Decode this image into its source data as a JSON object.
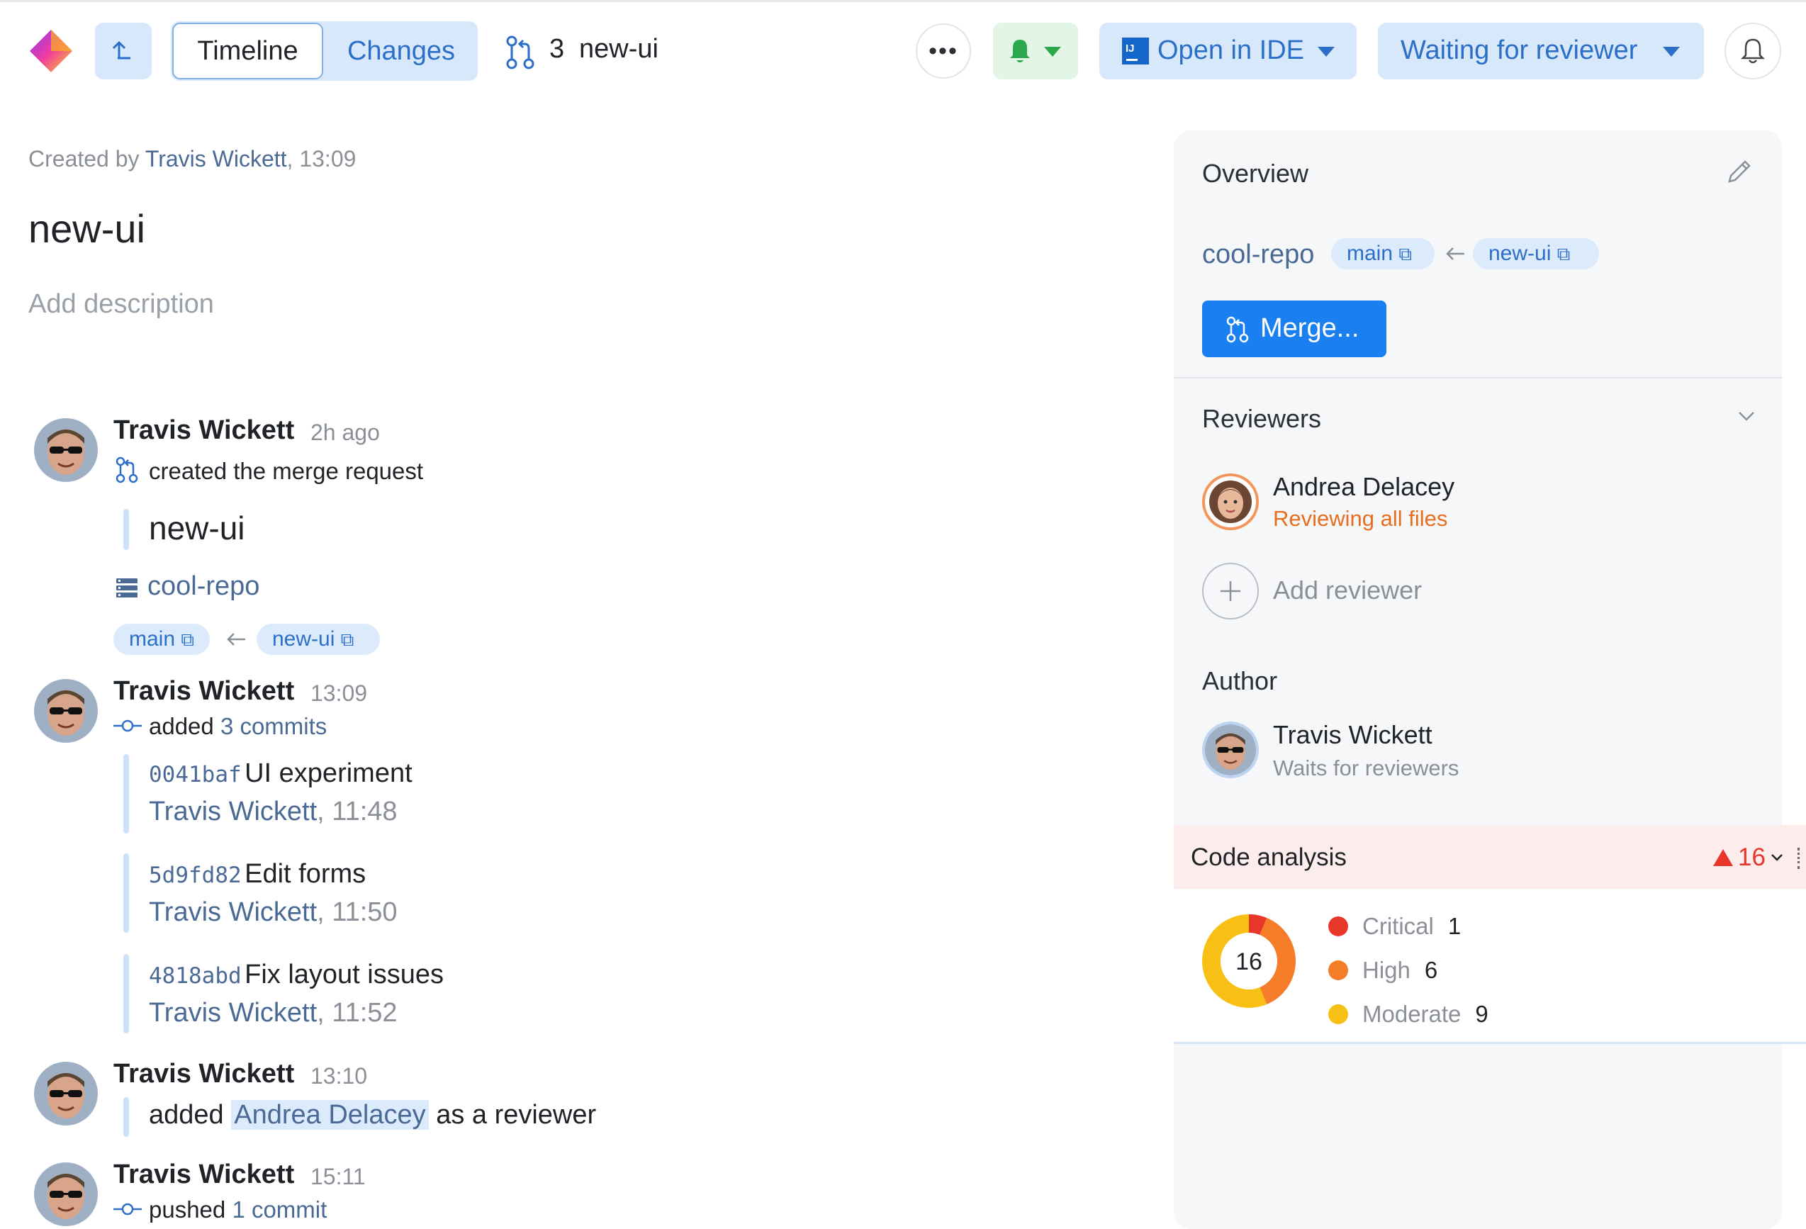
{
  "header": {
    "tabs": [
      {
        "label": "Timeline"
      },
      {
        "label": "Changes"
      }
    ],
    "mr_number": "3",
    "mr_branch": "new-ui",
    "open_in_ide": "Open in IDE",
    "status": "Waiting for reviewer"
  },
  "main": {
    "created_prefix": "Created by",
    "created_author": "Travis Wickett",
    "created_time": ", 13:09",
    "title": "new-ui",
    "add_description": "Add description"
  },
  "timeline": {
    "e1": {
      "author": "Travis Wickett",
      "time": "2h ago",
      "action": "created the merge request",
      "title": "new-ui",
      "repo": "cool-repo",
      "target": "main",
      "source": "new-ui"
    },
    "e2": {
      "author": "Travis Wickett",
      "time": "13:09",
      "action": "added",
      "link": "3 commits",
      "commits": [
        {
          "hash": "0041baf",
          "message": "UI experiment",
          "author": "Travis Wickett",
          "time": ", 11:48"
        },
        {
          "hash": "5d9fd82",
          "message": "Edit forms",
          "author": "Travis Wickett",
          "time": ", 11:50"
        },
        {
          "hash": "4818abd",
          "message": "Fix layout issues",
          "author": "Travis Wickett",
          "time": ", 11:52"
        }
      ]
    },
    "e3": {
      "author": "Travis Wickett",
      "time": "13:10",
      "pre": "added",
      "reviewer": "Andrea Delacey",
      "post": "as a reviewer"
    },
    "e4": {
      "author": "Travis Wickett",
      "time": "15:11",
      "action": "pushed",
      "link": "1 commit"
    }
  },
  "overview": {
    "title": "Overview",
    "repo": "cool-repo",
    "target": "main",
    "source": "new-ui",
    "merge_label": "Merge..."
  },
  "reviewers": {
    "title": "Reviewers",
    "reviewer_name": "Andrea Delacey",
    "reviewer_status": "Reviewing all files",
    "add_label": "Add reviewer"
  },
  "author": {
    "title": "Author",
    "name": "Travis Wickett",
    "status": "Waits for reviewers"
  },
  "code_analysis": {
    "title": "Code analysis",
    "total": "16",
    "items": [
      {
        "label": "Critical",
        "value": 1,
        "color": "#e8362b"
      },
      {
        "label": "High",
        "value": 6,
        "color": "#f57c29"
      },
      {
        "label": "Moderate",
        "value": 9,
        "color": "#f8c015"
      }
    ]
  },
  "colors": {
    "accent": "#1a7ff0",
    "link": "#4a6a95",
    "warning": "#e86e1f",
    "critical": "#e8362b"
  }
}
